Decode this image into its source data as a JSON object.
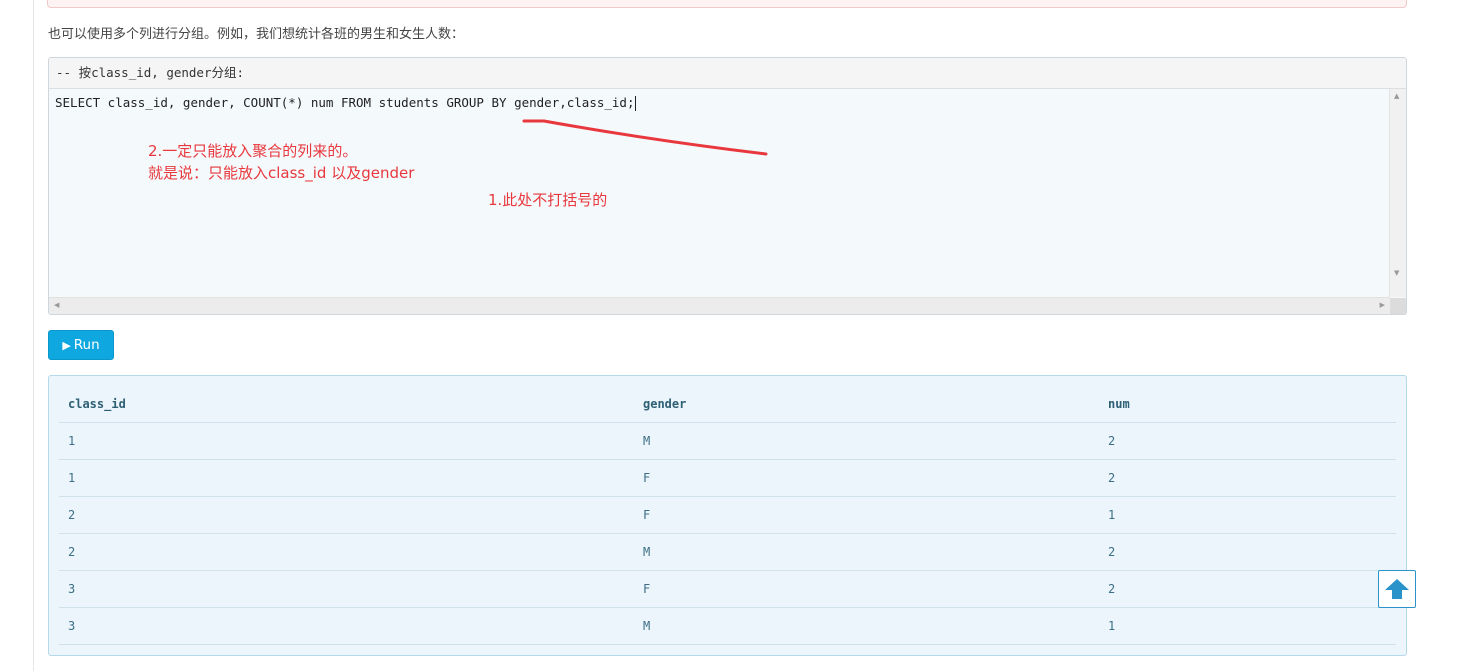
{
  "intro_text": "也可以使用多个列进行分组。例如，我们想统计各班的男生和女生人数：",
  "code": {
    "comment": "-- 按class_id, gender分组:",
    "sql": "SELECT class_id, gender, COUNT(*) num FROM students GROUP BY gender,class_id;"
  },
  "annotations": {
    "note2_line1": "2.一定只能放入聚合的列来的。",
    "note2_line2": "就是说：只能放入class_id 以及gender",
    "note1": "1.此处不打括号的",
    "color": "#e8383d"
  },
  "run_button": {
    "label": "Run",
    "icon": "play-icon"
  },
  "results": {
    "columns": [
      "class_id",
      "gender",
      "num"
    ],
    "rows": [
      [
        "1",
        "M",
        "2"
      ],
      [
        "1",
        "F",
        "2"
      ],
      [
        "2",
        "F",
        "1"
      ],
      [
        "2",
        "M",
        "2"
      ],
      [
        "3",
        "F",
        "2"
      ],
      [
        "3",
        "M",
        "1"
      ]
    ]
  },
  "back_to_top": {
    "icon": "arrow-up-icon"
  },
  "colors": {
    "accent": "#0fa7e0",
    "result_bg": "#ebf5fb"
  }
}
